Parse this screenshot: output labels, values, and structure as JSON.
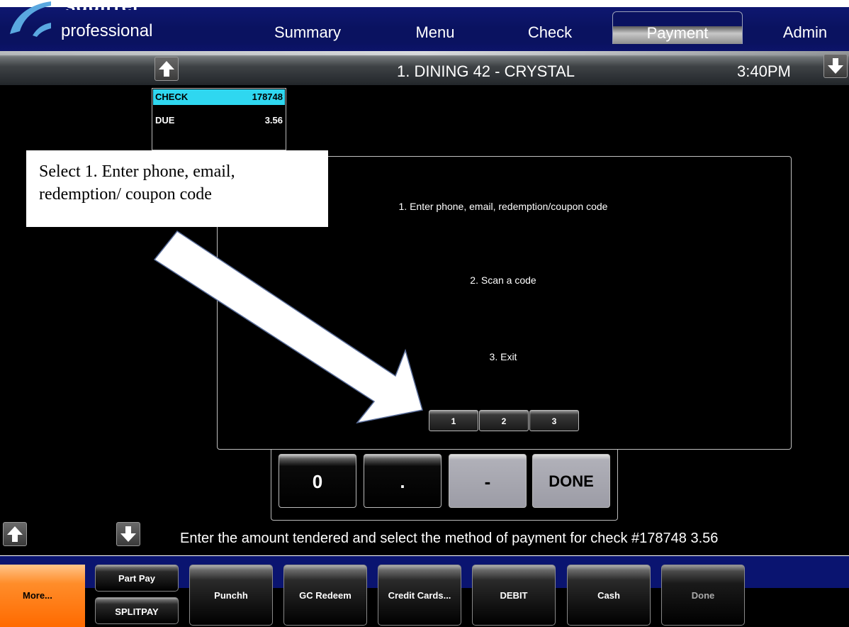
{
  "header": {
    "logo_top": "squirrel",
    "logo_text": "professional",
    "tabs": [
      {
        "label": "Summary"
      },
      {
        "label": "Menu"
      },
      {
        "label": "Check"
      },
      {
        "label": "Payment",
        "active": true
      },
      {
        "label": "Admin"
      }
    ]
  },
  "status": {
    "table_title": "1. DINING 42 - CRYSTAL",
    "time": "3:40PM"
  },
  "check": {
    "check_label": "CHECK",
    "check_number": "178748",
    "due_label": "DUE",
    "due_amount": "3.56"
  },
  "dialog": {
    "options": [
      "1. Enter phone, email, redemption/coupon code",
      "2. Scan a code",
      "3. Exit"
    ],
    "buttons": [
      "1",
      "2",
      "3"
    ]
  },
  "keypad": {
    "keys": [
      "0",
      ".",
      "-",
      "DONE"
    ]
  },
  "message": "Enter the amount tendered and select the method of payment for check #178748 3.56",
  "footer": {
    "more": "More...",
    "part_pay": "Part Pay",
    "splitpay": "SPLITPAY",
    "buttons": [
      "Punchh",
      "GC Redeem",
      "Credit Cards...",
      "DEBIT",
      "Cash",
      "Done"
    ]
  },
  "annotation": {
    "callout_text": "Select 1. Enter phone, email, redemption/ coupon code"
  },
  "colors": {
    "nav_blue": "#0a1260",
    "check_highlight": "#2fd7f0",
    "more_orange": "#ff8d2a"
  }
}
